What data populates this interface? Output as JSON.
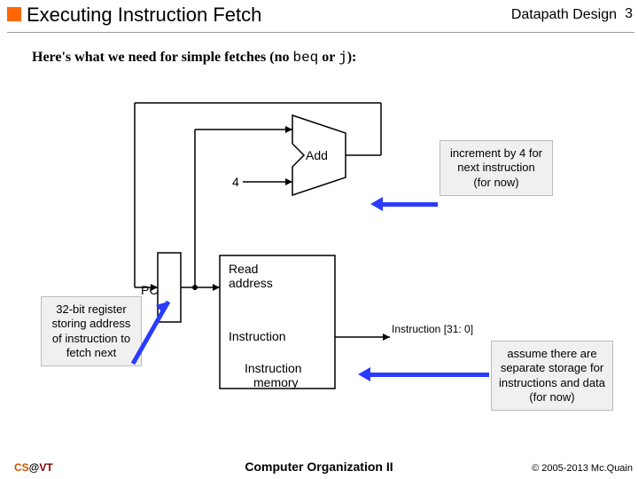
{
  "header": {
    "title": "Executing Instruction Fetch",
    "topic": "Datapath Design",
    "page": "3"
  },
  "intro": {
    "prefix": "Here's what we need for simple fetches (no ",
    "code1": "beq",
    "mid": " or ",
    "code2": "j",
    "suffix": "):"
  },
  "diagram": {
    "const4": "4",
    "add_label": "Add",
    "pc_label": "PC",
    "read_addr": "Read\naddress",
    "instr_port": "Instruction",
    "bus_label": "Instruction [31: 0]",
    "imem_label": "Instruction\nmemory"
  },
  "callouts": {
    "increment": "increment by 4 for next instruction (for now)",
    "pc": "32-bit register storing address of instruction to fetch next",
    "harvard": "assume there are separate storage for instructions and data (for now)"
  },
  "footer": {
    "left_cs": "CS",
    "left_at": "@",
    "left_vt": "VT",
    "center": "Computer Organization II",
    "right": "© 2005-2013 Mc.Quain"
  }
}
